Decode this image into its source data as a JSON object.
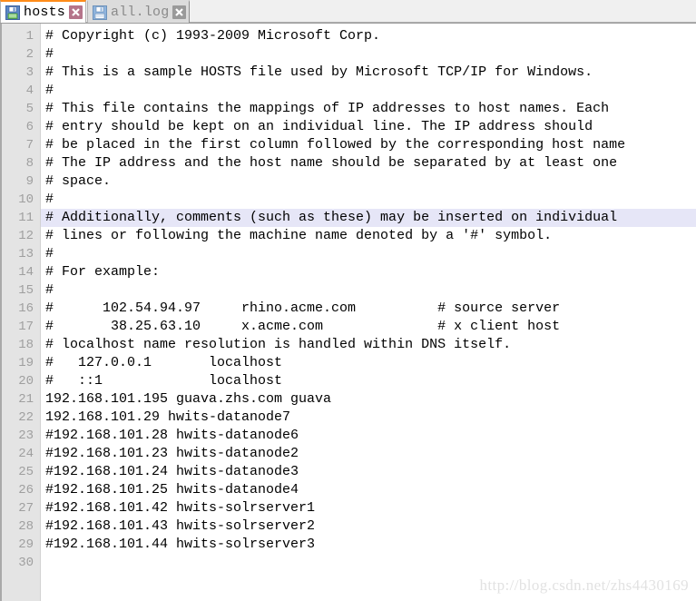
{
  "tabs": [
    {
      "label": "hosts",
      "active": true,
      "icon": "floppy-disk-icon",
      "close_icon": "close-icon"
    },
    {
      "label": "all.log",
      "active": false,
      "icon": "floppy-disk-icon",
      "close_icon": "close-icon"
    }
  ],
  "editor": {
    "total_lines": 30,
    "highlighted_line": 11,
    "line_numbers": [
      "1",
      "2",
      "3",
      "4",
      "5",
      "6",
      "7",
      "8",
      "9",
      "10",
      "11",
      "12",
      "13",
      "14",
      "15",
      "16",
      "17",
      "18",
      "19",
      "20",
      "21",
      "22",
      "23",
      "24",
      "25",
      "26",
      "27",
      "28",
      "29",
      "30"
    ],
    "lines": [
      "# Copyright (c) 1993-2009 Microsoft Corp.",
      "#",
      "# This is a sample HOSTS file used by Microsoft TCP/IP for Windows.",
      "#",
      "# This file contains the mappings of IP addresses to host names. Each",
      "# entry should be kept on an individual line. The IP address should",
      "# be placed in the first column followed by the corresponding host name",
      "# The IP address and the host name should be separated by at least one",
      "# space.",
      "#",
      "# Additionally, comments (such as these) may be inserted on individual",
      "# lines or following the machine name denoted by a '#' symbol.",
      "#",
      "# For example:",
      "#",
      "#      102.54.94.97     rhino.acme.com          # source server",
      "#       38.25.63.10     x.acme.com              # x client host",
      "# localhost name resolution is handled within DNS itself.",
      "#   127.0.0.1       localhost",
      "#   ::1             localhost",
      "192.168.101.195 guava.zhs.com guava",
      "192.168.101.29 hwits-datanode7",
      "#192.168.101.28 hwits-datanode6",
      "#192.168.101.23 hwits-datanode2",
      "#192.168.101.24 hwits-datanode3",
      "#192.168.101.25 hwits-datanode4",
      "#192.168.101.42 hwits-solrserver1",
      "#192.168.101.43 hwits-solrserver2",
      "#192.168.101.44 hwits-solrserver3",
      ""
    ]
  },
  "watermark": {
    "text": "http://blog.csdn.net/zhs4430169"
  },
  "colors": {
    "active_tab_accent": "#ff8c19",
    "active_close_bg": "#b5748a",
    "inactive_close_bg": "#9a9a9a",
    "gutter_bg": "#e4e4e4",
    "gutter_text": "#9f9f9f",
    "highlight_line_bg": "#e6e6f7",
    "editor_bg": "#ffffff",
    "tabbar_bg": "#f0f0f0",
    "watermark_text": "#e2e2e2"
  }
}
